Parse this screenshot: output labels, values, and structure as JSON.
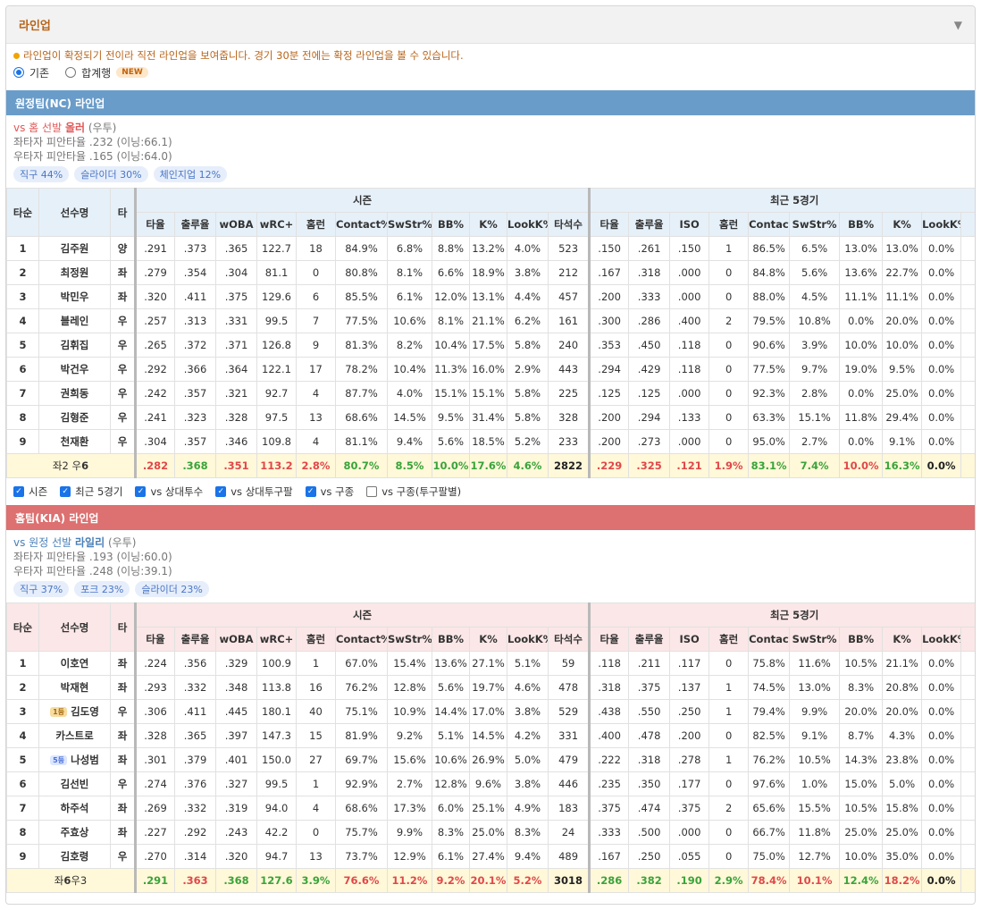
{
  "section": {
    "title": "라인업",
    "collapse_icon": "triangle-down-icon"
  },
  "notice": "라인업이 확정되기 전이라 직전 라인업을 보여줍니다. 경기 30분 전에는 확정 라인업을 볼 수 있습니다.",
  "view_options": [
    {
      "label": "기존",
      "selected": true
    },
    {
      "label": "합계행",
      "selected": false,
      "badge": "NEW"
    }
  ],
  "colors": {
    "away_bar": "#6a9cc9",
    "home_bar": "#dd7070",
    "good": "#3aa33a",
    "bad": "#e04848",
    "title": "#b8651a"
  },
  "headers": {
    "order": "타순",
    "player": "선수명",
    "bat": "타",
    "season": "시즌",
    "recent": "최근 5경기",
    "season_cols": [
      "타율",
      "출루율",
      "wOBA",
      "wRC+",
      "홈런",
      "Contact%",
      "SwStr%",
      "BB%",
      "K%",
      "LookK%",
      "타석수"
    ],
    "recent_cols": [
      "타율",
      "출루율",
      "ISO",
      "홈런",
      "Contact%",
      "SwStr%",
      "BB%",
      "K%",
      "LookK%"
    ]
  },
  "away": {
    "bar_title": "원정팀(NC) 라인업",
    "pitcher": {
      "vs_prefix": "vs 홈 선발",
      "name": "올러",
      "hand": "(우투)"
    },
    "splits": [
      "좌타자 피안타율 .232 (이닝:66.1)",
      "우타자 피안타율 .165 (이닝:64.0)"
    ],
    "pitches": [
      "직구 44%",
      "슬라이더 30%",
      "체인지업 12%"
    ],
    "rows": [
      {
        "n": "1",
        "name": "김주원",
        "bat": "양",
        "s": [
          ".291",
          ".373",
          ".365",
          "122.7",
          "18",
          "84.9%",
          "6.8%",
          "8.8%",
          "13.2%",
          "4.0%",
          "523"
        ],
        "r": [
          ".150",
          ".261",
          ".150",
          "1",
          "86.5%",
          "6.5%",
          "13.0%",
          "13.0%",
          "0.0%"
        ]
      },
      {
        "n": "2",
        "name": "최정원",
        "bat": "좌",
        "s": [
          ".279",
          ".354",
          ".304",
          "81.1",
          "0",
          "80.8%",
          "8.1%",
          "6.6%",
          "18.9%",
          "3.8%",
          "212"
        ],
        "r": [
          ".167",
          ".318",
          ".000",
          "0",
          "84.8%",
          "5.6%",
          "13.6%",
          "22.7%",
          "0.0%"
        ]
      },
      {
        "n": "3",
        "name": "박민우",
        "bat": "좌",
        "s": [
          ".320",
          ".411",
          ".375",
          "129.6",
          "6",
          "85.5%",
          "6.1%",
          "12.0%",
          "13.1%",
          "4.4%",
          "457"
        ],
        "r": [
          ".200",
          ".333",
          ".000",
          "0",
          "88.0%",
          "4.5%",
          "11.1%",
          "11.1%",
          "0.0%"
        ]
      },
      {
        "n": "4",
        "name": "블레인",
        "bat": "우",
        "s": [
          ".257",
          ".313",
          ".331",
          "99.5",
          "7",
          "77.5%",
          "10.6%",
          "8.1%",
          "21.1%",
          "6.2%",
          "161"
        ],
        "r": [
          ".300",
          ".286",
          ".400",
          "2",
          "79.5%",
          "10.8%",
          "0.0%",
          "20.0%",
          "0.0%"
        ]
      },
      {
        "n": "5",
        "name": "김휘집",
        "bat": "우",
        "s": [
          ".265",
          ".372",
          ".371",
          "126.8",
          "9",
          "81.3%",
          "8.2%",
          "10.4%",
          "17.5%",
          "5.8%",
          "240"
        ],
        "r": [
          ".353",
          ".450",
          ".118",
          "0",
          "90.6%",
          "3.9%",
          "10.0%",
          "10.0%",
          "0.0%"
        ]
      },
      {
        "n": "6",
        "name": "박건우",
        "bat": "우",
        "s": [
          ".292",
          ".366",
          ".364",
          "122.1",
          "17",
          "78.2%",
          "10.4%",
          "11.3%",
          "16.0%",
          "2.9%",
          "443"
        ],
        "r": [
          ".294",
          ".429",
          ".118",
          "0",
          "77.5%",
          "9.7%",
          "19.0%",
          "9.5%",
          "0.0%"
        ]
      },
      {
        "n": "7",
        "name": "권희동",
        "bat": "우",
        "s": [
          ".242",
          ".357",
          ".321",
          "92.7",
          "4",
          "87.7%",
          "4.0%",
          "15.1%",
          "15.1%",
          "5.8%",
          "225"
        ],
        "r": [
          ".125",
          ".125",
          ".000",
          "0",
          "92.3%",
          "2.8%",
          "0.0%",
          "25.0%",
          "0.0%"
        ]
      },
      {
        "n": "8",
        "name": "김형준",
        "bat": "우",
        "s": [
          ".241",
          ".323",
          ".328",
          "97.5",
          "13",
          "68.6%",
          "14.5%",
          "9.5%",
          "31.4%",
          "5.8%",
          "328"
        ],
        "r": [
          ".200",
          ".294",
          ".133",
          "0",
          "63.3%",
          "15.1%",
          "11.8%",
          "29.4%",
          "0.0%"
        ]
      },
      {
        "n": "9",
        "name": "천재환",
        "bat": "우",
        "s": [
          ".304",
          ".357",
          ".346",
          "109.8",
          "4",
          "81.1%",
          "9.4%",
          "5.6%",
          "18.5%",
          "5.2%",
          "233"
        ],
        "r": [
          ".200",
          ".273",
          ".000",
          "0",
          "95.0%",
          "2.7%",
          "0.0%",
          "9.1%",
          "0.0%"
        ]
      }
    ],
    "total": {
      "label_left": "좌2 우",
      "label_bold": "6",
      "s": [
        ".282",
        ".368",
        ".351",
        "113.2",
        "2.8%",
        "80.7%",
        "8.5%",
        "10.0%",
        "17.6%",
        "4.6%",
        "2822"
      ],
      "s_tone": [
        "red",
        "green",
        "red",
        "red",
        "red",
        "green",
        "green",
        "green",
        "green",
        "green",
        "black"
      ],
      "r": [
        ".229",
        ".325",
        ".121",
        "1.9%",
        "83.1%",
        "7.4%",
        "10.0%",
        "16.3%",
        "0.0%"
      ],
      "r_tone": [
        "red",
        "red",
        "red",
        "red",
        "green",
        "green",
        "red",
        "green",
        "black"
      ]
    }
  },
  "filters": [
    {
      "label": "시즌",
      "checked": true
    },
    {
      "label": "최근 5경기",
      "checked": true
    },
    {
      "label": "vs 상대투수",
      "checked": true
    },
    {
      "label": "vs 상대투구팔",
      "checked": true
    },
    {
      "label": "vs 구종",
      "checked": true
    },
    {
      "label": "vs 구종(투구팔별)",
      "checked": false
    }
  ],
  "home": {
    "bar_title": "홈팀(KIA) 라인업",
    "pitcher": {
      "vs_prefix": "vs 원정 선발",
      "name": "라일리",
      "hand": "(우투)"
    },
    "splits": [
      "좌타자 피안타율 .193 (이닝:60.0)",
      "우타자 피안타율 .248 (이닝:39.1)"
    ],
    "pitches": [
      "직구 37%",
      "포크 23%",
      "슬라이더 23%"
    ],
    "rows": [
      {
        "n": "1",
        "name": "이호연",
        "bat": "좌",
        "s": [
          ".224",
          ".356",
          ".329",
          "100.9",
          "1",
          "67.0%",
          "15.4%",
          "13.6%",
          "27.1%",
          "5.1%",
          "59"
        ],
        "r": [
          ".118",
          ".211",
          ".117",
          "0",
          "75.8%",
          "11.6%",
          "10.5%",
          "21.1%",
          "0.0%"
        ]
      },
      {
        "n": "2",
        "name": "박재현",
        "bat": "좌",
        "s": [
          ".293",
          ".332",
          ".348",
          "113.8",
          "16",
          "76.2%",
          "12.8%",
          "5.6%",
          "19.7%",
          "4.6%",
          "478"
        ],
        "r": [
          ".318",
          ".375",
          ".137",
          "1",
          "74.5%",
          "13.0%",
          "8.3%",
          "20.8%",
          "0.0%"
        ]
      },
      {
        "n": "3",
        "name": "김도영",
        "bat": "우",
        "rank": "1등",
        "rank_tone": "gold",
        "s": [
          ".306",
          ".411",
          ".445",
          "180.1",
          "40",
          "75.1%",
          "10.9%",
          "14.4%",
          "17.0%",
          "3.8%",
          "529"
        ],
        "r": [
          ".438",
          ".550",
          ".250",
          "1",
          "79.4%",
          "9.9%",
          "20.0%",
          "20.0%",
          "0.0%"
        ]
      },
      {
        "n": "4",
        "name": "카스트로",
        "bat": "좌",
        "s": [
          ".328",
          ".365",
          ".397",
          "147.3",
          "15",
          "81.9%",
          "9.2%",
          "5.1%",
          "14.5%",
          "4.2%",
          "331"
        ],
        "r": [
          ".400",
          ".478",
          ".200",
          "0",
          "82.5%",
          "9.1%",
          "8.7%",
          "4.3%",
          "0.0%"
        ]
      },
      {
        "n": "5",
        "name": "나성범",
        "bat": "좌",
        "rank": "5등",
        "rank_tone": "blue",
        "s": [
          ".301",
          ".379",
          ".401",
          "150.0",
          "27",
          "69.7%",
          "15.6%",
          "10.6%",
          "26.9%",
          "5.0%",
          "479"
        ],
        "r": [
          ".222",
          ".318",
          ".278",
          "1",
          "76.2%",
          "10.5%",
          "14.3%",
          "23.8%",
          "0.0%"
        ]
      },
      {
        "n": "6",
        "name": "김선빈",
        "bat": "우",
        "s": [
          ".274",
          ".376",
          ".327",
          "99.5",
          "1",
          "92.9%",
          "2.7%",
          "12.8%",
          "9.6%",
          "3.8%",
          "446"
        ],
        "r": [
          ".235",
          ".350",
          ".177",
          "0",
          "97.6%",
          "1.0%",
          "15.0%",
          "5.0%",
          "0.0%"
        ]
      },
      {
        "n": "7",
        "name": "하주석",
        "bat": "좌",
        "s": [
          ".269",
          ".332",
          ".319",
          "94.0",
          "4",
          "68.6%",
          "17.3%",
          "6.0%",
          "25.1%",
          "4.9%",
          "183"
        ],
        "r": [
          ".375",
          ".474",
          ".375",
          "2",
          "65.6%",
          "15.5%",
          "10.5%",
          "15.8%",
          "0.0%"
        ]
      },
      {
        "n": "8",
        "name": "주효상",
        "bat": "좌",
        "s": [
          ".227",
          ".292",
          ".243",
          "42.2",
          "0",
          "75.7%",
          "9.9%",
          "8.3%",
          "25.0%",
          "8.3%",
          "24"
        ],
        "r": [
          ".333",
          ".500",
          ".000",
          "0",
          "66.7%",
          "11.8%",
          "25.0%",
          "25.0%",
          "0.0%"
        ]
      },
      {
        "n": "9",
        "name": "김호령",
        "bat": "우",
        "s": [
          ".270",
          ".314",
          ".320",
          "94.7",
          "13",
          "73.7%",
          "12.9%",
          "6.1%",
          "27.4%",
          "9.4%",
          "489"
        ],
        "r": [
          ".167",
          ".250",
          ".055",
          "0",
          "75.0%",
          "12.7%",
          "10.0%",
          "35.0%",
          "0.0%"
        ]
      }
    ],
    "total": {
      "label_left": "좌",
      "label_bold": "6",
      "label_right": "우3",
      "s": [
        ".291",
        ".363",
        ".368",
        "127.6",
        "3.9%",
        "76.6%",
        "11.2%",
        "9.2%",
        "20.1%",
        "5.2%",
        "3018"
      ],
      "s_tone": [
        "green",
        "red",
        "green",
        "green",
        "green",
        "red",
        "red",
        "red",
        "red",
        "red",
        "black"
      ],
      "r": [
        ".286",
        ".382",
        ".190",
        "2.9%",
        "78.4%",
        "10.1%",
        "12.4%",
        "18.2%",
        "0.0%"
      ],
      "r_tone": [
        "green",
        "green",
        "green",
        "green",
        "red",
        "red",
        "green",
        "red",
        "black"
      ]
    }
  }
}
